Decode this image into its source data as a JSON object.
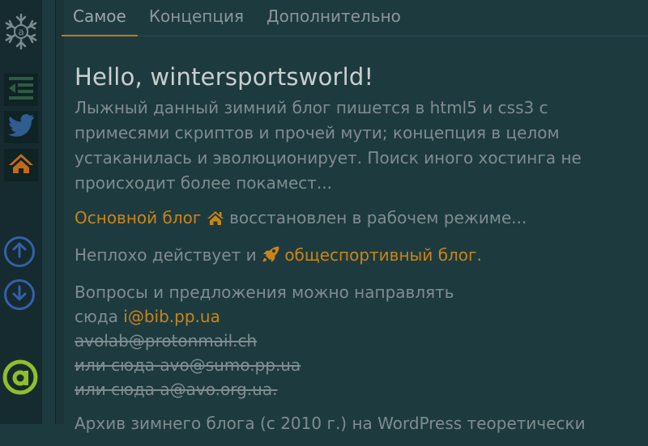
{
  "tabs": [
    {
      "label": "Самое"
    },
    {
      "label": "Концепция"
    },
    {
      "label": "Дополнительно"
    }
  ],
  "sidebar": {
    "icons": [
      "snowflake-icon",
      "menu-icon",
      "twitter-icon",
      "home-icon",
      "arrow-up-icon",
      "arrow-down-icon",
      "a-logo-icon"
    ]
  },
  "content": {
    "greeting": "Hello, wintersportsworld!",
    "intro": "Лыжный данный зимний блог пишется в html5 и css3 с примесями скриптов и прочей мути; концепция в целом устаканилась и эволюционирует. Поиск иного хостинга не происходит более покамест...",
    "main_blog_link": "Основной блог",
    "main_blog_rest": "восстановлен в рабочем режиме...",
    "sport_prefix": "Неплохо действует и",
    "sport_link": "общеспортивный блог.",
    "contact_text": "Вопросы и предложения можно направлять",
    "contact_here": "сюда",
    "contact_email": "i@bib.pp.ua",
    "old_email_1": "avolab@protonmail.ch",
    "old_email_2": "или сюда avo@sumo.pp.ua",
    "old_email_3": "или сюда a@avo.org.ua.",
    "archive_text": "Архив зимнего блога (с 2010 г.) на WordPress теоретически"
  },
  "colors": {
    "background": "#1d3b3f",
    "accent": "#c98419",
    "text": "#7f8c90",
    "heading": "#c9cfd1",
    "circle_blue": "#3560a8",
    "logo_green": "#8fbf2a"
  }
}
